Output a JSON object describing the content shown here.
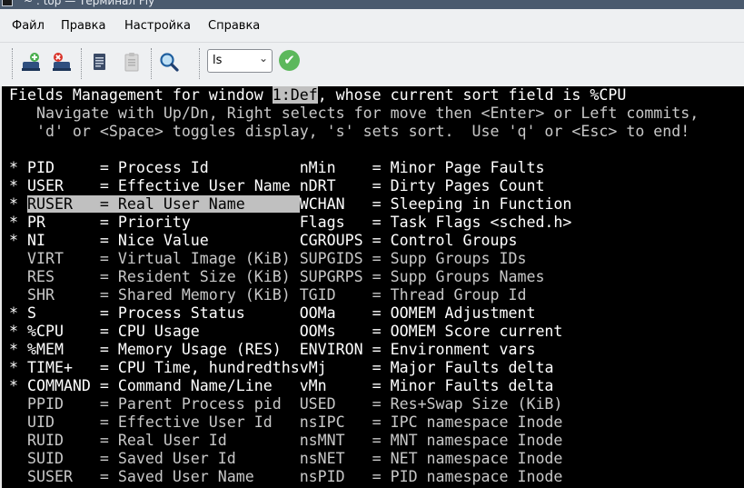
{
  "window": {
    "title": "~ : top — Терминал Fly"
  },
  "menu": {
    "items": [
      "Файл",
      "Правка",
      "Настройка",
      "Справка"
    ]
  },
  "toolbar": {
    "combo_value": "ls"
  },
  "terminal": {
    "header": {
      "prefix": "Fields Management",
      "mid": " for window ",
      "tag": "1:Def",
      "rest": ", whose current sort field is %CPU"
    },
    "help_line_1": "   Navigate with Up/Dn, Right selects for move then <Enter> or Left commits,",
    "help_line_2": "   'd' or <Space> toggles display, 's' sets sort.  Use 'q' or <Esc> to end!",
    "rows": [
      {
        "left": "* PID     = Process Id         ",
        "right": " nMin    = Minor Page Faults"
      },
      {
        "left": "* USER    = Effective User Name",
        "right": " nDRT    = Dirty Pages Count"
      },
      {
        "mark": "* ",
        "sel": "RUSER   = Real User Name      ",
        "right": "WCHAN   = Sleeping in Function"
      },
      {
        "left": "* PR      = Priority           ",
        "right": " Flags   = Task Flags <sched.h>"
      },
      {
        "left": "* NI      = Nice Value         ",
        "right": " CGROUPS = Control Groups"
      },
      {
        "left": "  VIRT    = Virtual Image (KiB)",
        "right": " SUPGIDS = Supp Groups IDs"
      },
      {
        "left": "  RES     = Resident Size (KiB)",
        "right": " SUPGRPS = Supp Groups Names"
      },
      {
        "left": "  SHR     = Shared Memory (KiB)",
        "right": " TGID    = Thread Group Id"
      },
      {
        "left": "* S       = Process Status     ",
        "right": " OOMa    = OOMEM Adjustment"
      },
      {
        "left": "* %CPU    = CPU Usage          ",
        "right": " OOMs    = OOMEM Score current"
      },
      {
        "left": "* %MEM    = Memory Usage (RES) ",
        "right": " ENVIRON = Environment vars"
      },
      {
        "left": "* TIME+   = CPU Time, hundredths",
        "right": "vMj     = Major Faults delta"
      },
      {
        "left": "* COMMAND = Command Name/Line  ",
        "right": " vMn     = Minor Faults delta"
      },
      {
        "left": "  PPID    = Parent Process pid ",
        "right": " USED    = Res+Swap Size (KiB)"
      },
      {
        "left": "  UID     = Effective User Id  ",
        "right": " nsIPC   = IPC namespace Inode"
      },
      {
        "left": "  RUID    = Real User Id       ",
        "right": " nsMNT   = MNT namespace Inode"
      },
      {
        "left": "  SUID    = Saved User Id      ",
        "right": " nsNET   = NET namespace Inode"
      },
      {
        "left": "  SUSER   = Saved User Name    ",
        "right": " nsPID   = PID namespace Inode"
      }
    ]
  }
}
